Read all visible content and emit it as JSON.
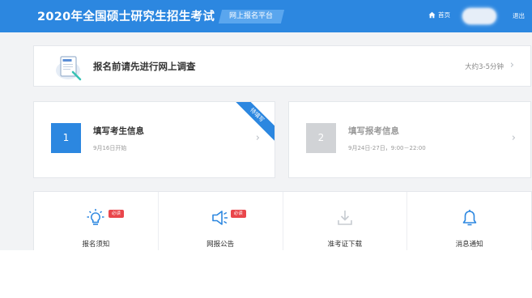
{
  "header": {
    "title": "2020年全国硕士研究生招生考试",
    "platform": "网上报名平台",
    "home_label": "首页",
    "logout_label": "退出"
  },
  "survey": {
    "title": "报名前请先进行网上调查",
    "time_hint": "大约3-5分钟"
  },
  "steps": [
    {
      "number": "1",
      "title": "填写考生信息",
      "date": "9月16日开始",
      "ribbon": "待填写",
      "state": "active"
    },
    {
      "number": "2",
      "title": "填写报考信息",
      "date": "9月24日-27日，9:00－22:00",
      "state": "inactive"
    }
  ],
  "links": [
    {
      "label": "报名须知",
      "icon": "lightbulb-icon",
      "badge": "必读"
    },
    {
      "label": "网报公告",
      "icon": "megaphone-icon",
      "badge": "必读"
    },
    {
      "label": "准考证下载",
      "icon": "download-icon"
    },
    {
      "label": "消息通知",
      "icon": "bell-icon"
    }
  ],
  "colors": {
    "primary": "#2c87e0",
    "badge": "#e9464b",
    "inactive": "#d1d3d6",
    "background": "#f2f3f5"
  }
}
